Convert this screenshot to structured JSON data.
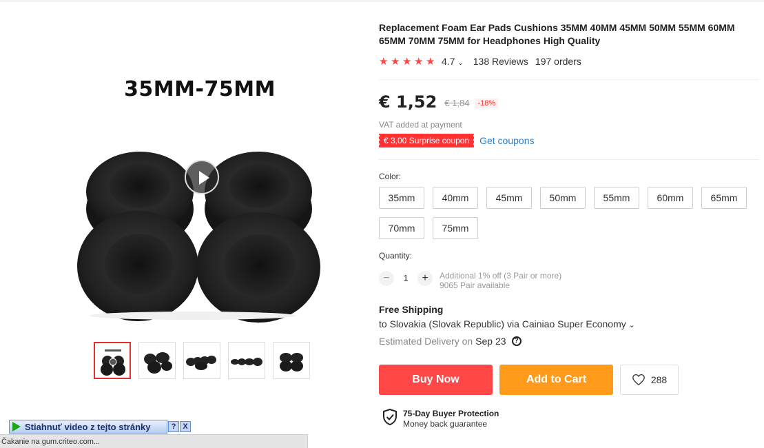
{
  "gallery": {
    "caption": "35MM-75MM",
    "play_icon": "play-icon",
    "thumbnails": [
      {
        "name": "thumbnail-1",
        "active": true
      },
      {
        "name": "thumbnail-2",
        "active": false
      },
      {
        "name": "thumbnail-3",
        "active": false
      },
      {
        "name": "thumbnail-4",
        "active": false
      },
      {
        "name": "thumbnail-5",
        "active": false
      }
    ]
  },
  "product": {
    "title": "Replacement Foam Ear Pads Cushions 35MM 40MM 45MM 50MM 55MM 60MM 65MM 70MM 75MM for Headphones High Quality",
    "rating": "4.7",
    "stars": 5,
    "reviews": "138 Reviews",
    "orders": "197 orders",
    "price": "€ 1,52",
    "old_price": "€ 1,84",
    "discount": "-18%",
    "vat_note": "VAT added at payment",
    "coupon": "€ 3,00 Surprise coupon",
    "get_coupons": "Get coupons"
  },
  "options": {
    "color_label": "Color:",
    "variants": [
      "35mm",
      "40mm",
      "45mm",
      "50mm",
      "55mm",
      "60mm",
      "65mm",
      "70mm",
      "75mm"
    ],
    "quantity_label": "Quantity:",
    "quantity_value": "1",
    "minus": "−",
    "plus": "+",
    "additional_off": "Additional 1% off (3 Pair or more)",
    "available": "9065 Pair available"
  },
  "shipping": {
    "title": "Free Shipping",
    "to": "to Slovakia (Slovak Republic) via Cainiao Super Economy",
    "estimated_label": "Estimated Delivery on",
    "date": "Sep 23",
    "help": "?"
  },
  "actions": {
    "buy_now": "Buy Now",
    "add_to_cart": "Add to Cart",
    "wishlist_count": "288"
  },
  "protection": {
    "title": "75-Day Buyer Protection",
    "subtitle": "Money back guarantee"
  },
  "browser": {
    "download_label": "Stiahnuť video z tejto stránky",
    "help_btn": "?",
    "close_btn": "X",
    "status": "Čakanie na gum.criteo.com..."
  },
  "colors": {
    "accent_red": "#ff4747",
    "accent_orange": "#ff9a1a",
    "star_red": "#ff4444",
    "link_blue": "#2e7ec6"
  }
}
